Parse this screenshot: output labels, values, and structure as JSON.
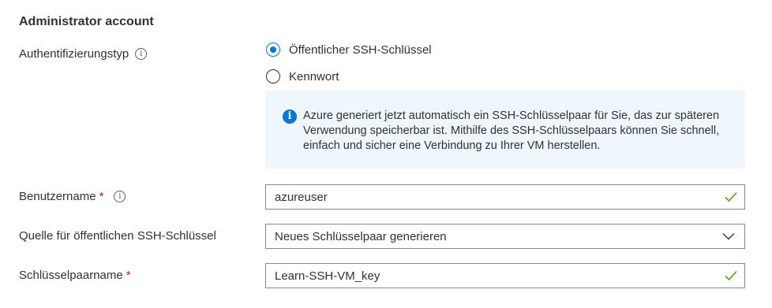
{
  "section": {
    "title": "Administrator account"
  },
  "auth": {
    "label": "Authentifizierungstyp",
    "info_icon": "info-icon",
    "options": [
      {
        "label": "Öffentlicher SSH-Schlüssel",
        "checked": true
      },
      {
        "label": "Kennwort",
        "checked": false
      }
    ]
  },
  "infobox": {
    "icon": "info-filled-icon",
    "color": "#0078d4",
    "text": "Azure generiert jetzt automatisch ein SSH-Schlüsselpaar für Sie, das zur späteren Verwendung speicherbar ist. Mithilfe des SSH-Schlüsselpaars können Sie schnell, einfach und sicher eine Verbindung zu Ihrer VM herstellen."
  },
  "username": {
    "label": "Benutzername",
    "required_mark": "*",
    "value": "azureuser",
    "status_icon": "checkmark-icon"
  },
  "ssh_source": {
    "label": "Quelle für öffentlichen SSH-Schlüssel",
    "selected": "Neues Schlüsselpaar generieren"
  },
  "key_name": {
    "label": "Schlüsselpaarname",
    "required_mark": "*",
    "value": "Learn-SSH-VM_key",
    "status_icon": "checkmark-icon"
  }
}
